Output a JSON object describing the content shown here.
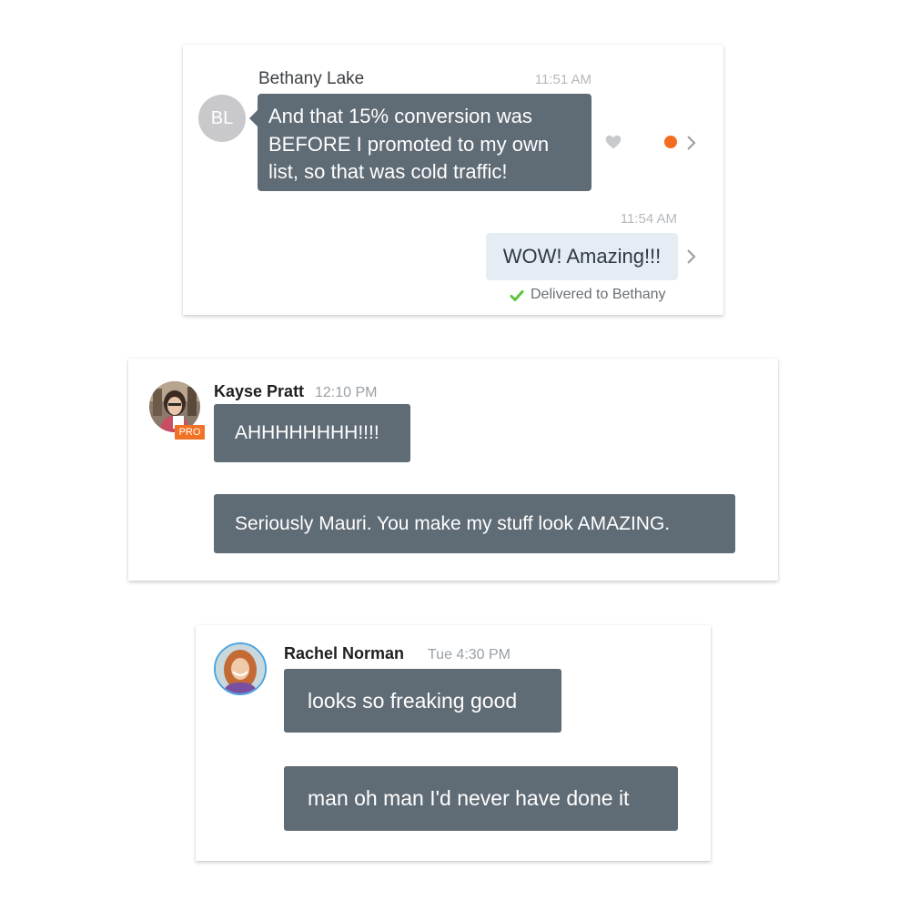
{
  "conversation1": {
    "incoming": {
      "sender_name": "Bethany Lake",
      "avatar_initials": "BL",
      "time": "11:51 AM",
      "message": "And that 15% conversion was BEFORE I promoted to my own list, so that was cold traffic!"
    },
    "outgoing": {
      "time": "11:54 AM",
      "message": "WOW! Amazing!!!",
      "status": "Delivered to Bethany"
    },
    "icons": {
      "heart": "heart-icon",
      "unread_dot": "unread-dot-icon",
      "chevron": "chevron-right-icon",
      "check": "check-icon"
    },
    "colors": {
      "bubble": "#5f6b75",
      "outgoing_bubble": "#e5ecf3",
      "unread_dot": "#f26d1f",
      "check": "#5cc43a"
    }
  },
  "conversation2": {
    "sender_name": "Kayse Pratt",
    "time": "12:10 PM",
    "badge": "PRO",
    "messages": [
      "AHHHHHHHH!!!!",
      "Seriously Mauri. You make my stuff look AMAZING."
    ],
    "colors": {
      "badge": "#f27225"
    }
  },
  "conversation3": {
    "sender_name": "Rachel Norman",
    "time": "Tue 4:30 PM",
    "messages": [
      "looks so freaking good",
      "man oh man I'd never have done it"
    ],
    "colors": {
      "avatar_ring": "#4aa3df"
    }
  }
}
